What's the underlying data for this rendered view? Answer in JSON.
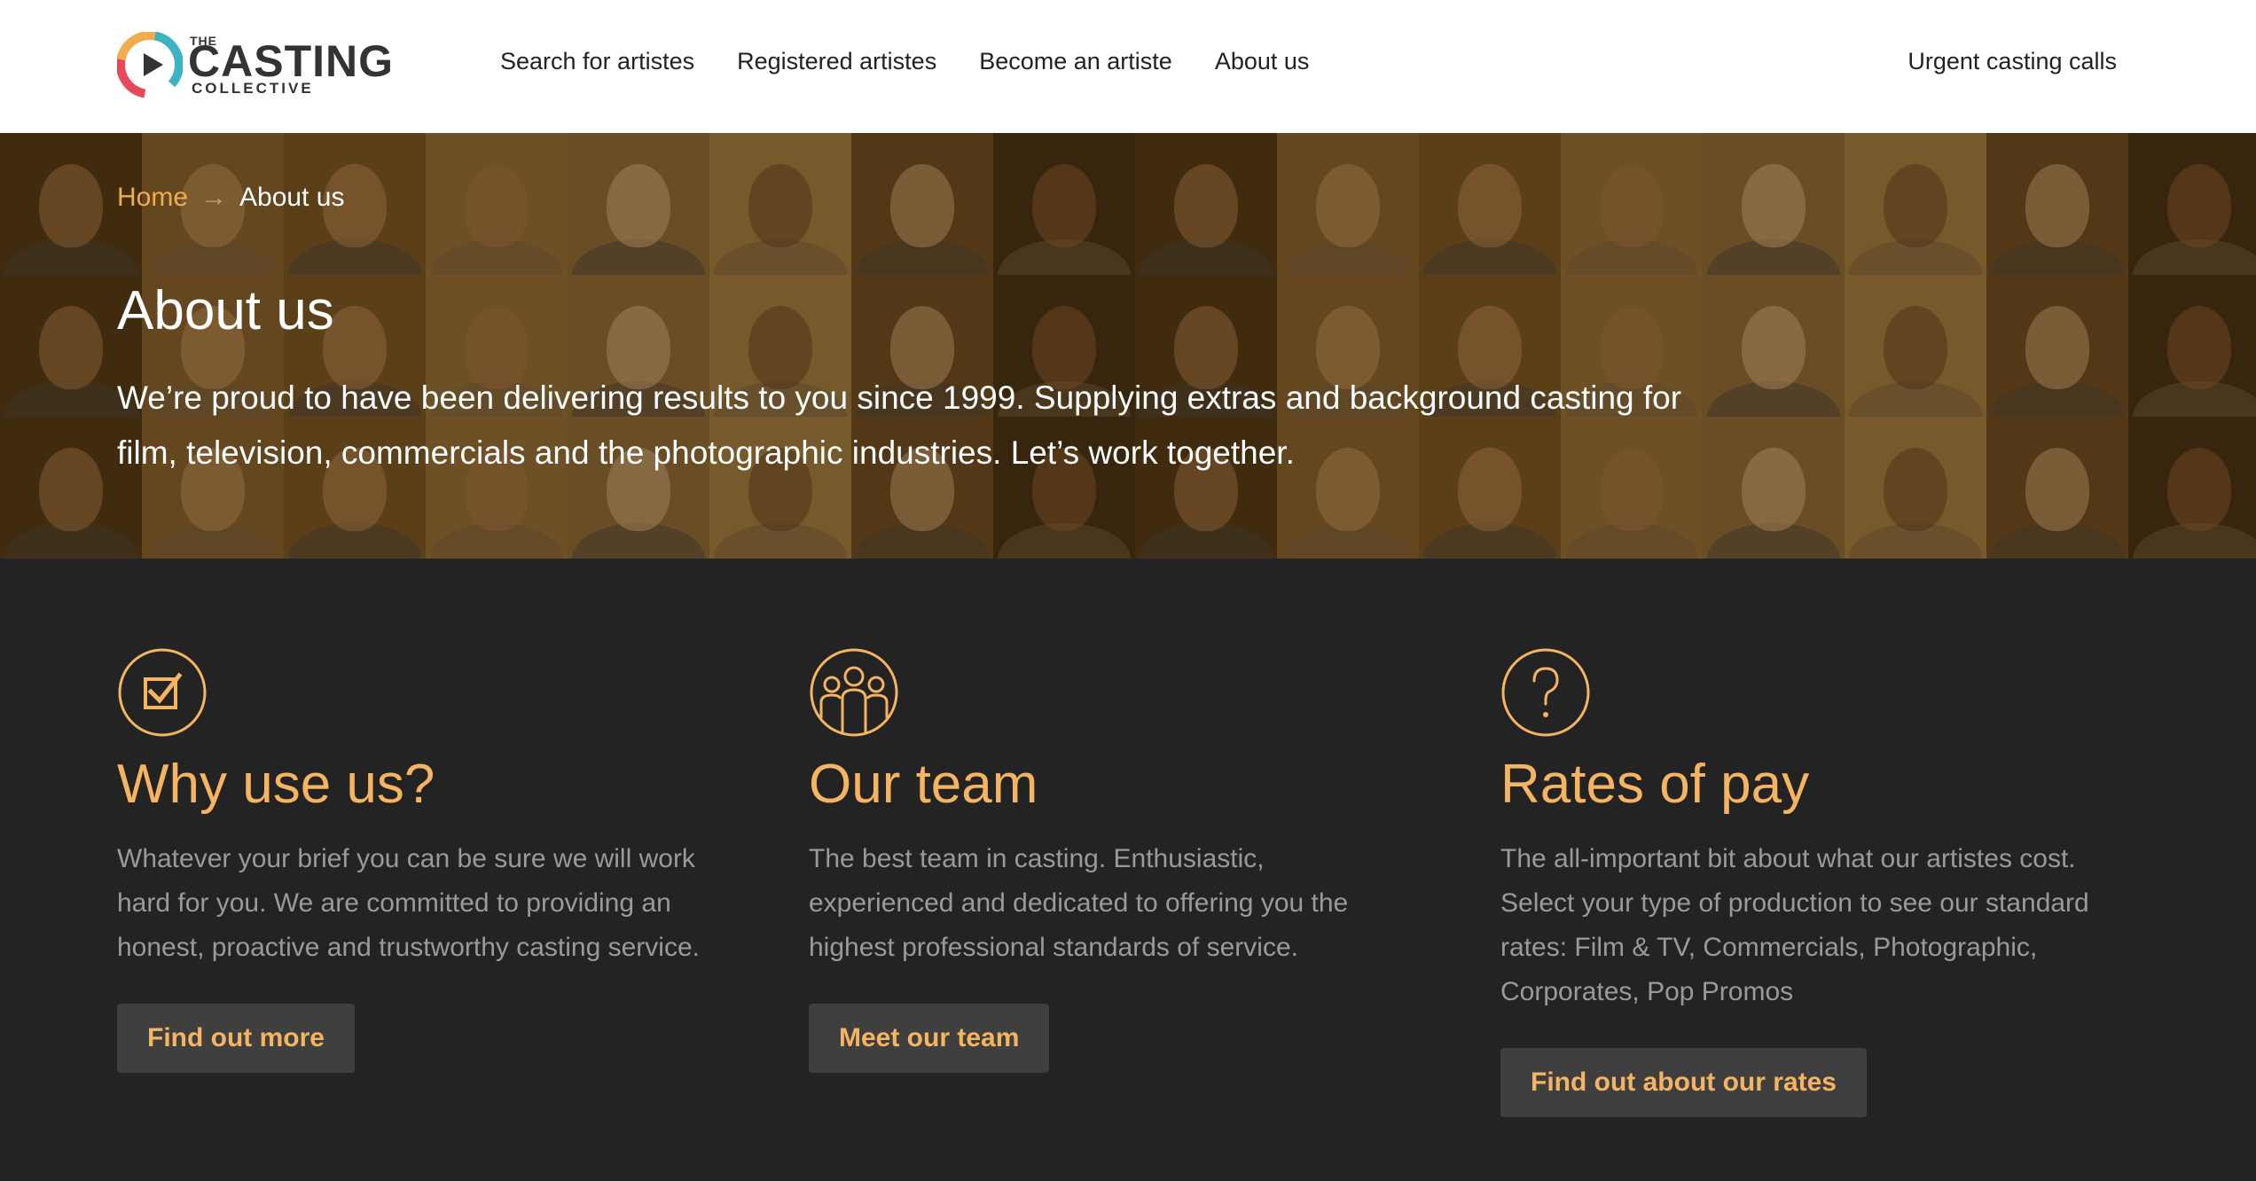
{
  "logo": {
    "the": "THE",
    "casting": "CASTING",
    "collective": "COLLECTIVE"
  },
  "nav": {
    "items": [
      "Search for artistes",
      "Registered artistes",
      "Become an artiste",
      "About us"
    ],
    "urgent": "Urgent casting calls"
  },
  "breadcrumb": {
    "home": "Home",
    "separator": "→",
    "current": "About us"
  },
  "hero": {
    "title": "About us",
    "text": "We’re proud to have been delivering results to you since 1999. Supplying extras and background casting for film, television, commercials and the photographic industries. Let’s work together."
  },
  "features": [
    {
      "icon": "checkbox-icon",
      "title": "Why use us?",
      "text": "Whatever your brief you can be sure we will work hard for you. We are committed to providing an honest, proactive and trustworthy casting service.",
      "button": "Find out more"
    },
    {
      "icon": "team-icon",
      "title": "Our team",
      "text": "The best team in casting. Enthusiastic, experienced and dedicated to offering you the highest professional standards of service.",
      "button": "Meet our team"
    },
    {
      "icon": "question-icon",
      "title": "Rates of pay",
      "text": "The all-important bit about what our artistes cost. Select your type of production to see our standard rates: Film & TV, Commercials, Photographic, Corporates, Pop Promos",
      "button": "Find out about our rates"
    }
  ],
  "colors": {
    "accent": "#f5b461",
    "breadcrumb_link": "#f0ad4e",
    "dark_bg": "#232323",
    "button_bg": "#3f3f3f",
    "body_text": "#9a9a9a"
  }
}
